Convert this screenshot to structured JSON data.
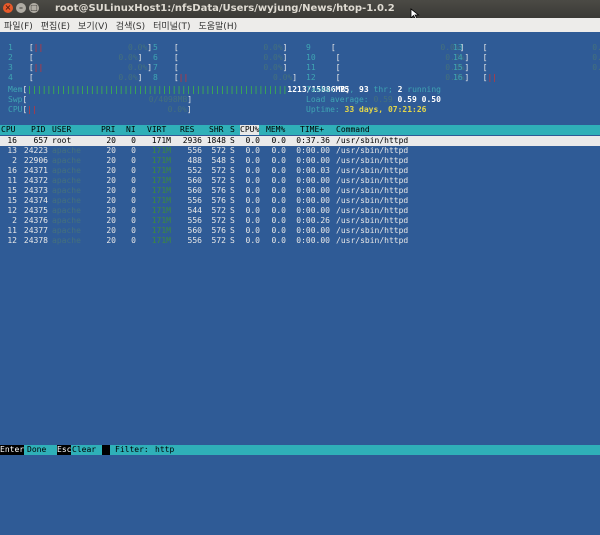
{
  "window": {
    "title": "root@SULinuxHost1:/nfsData/Users/wyjung/News/htop-1.0.2",
    "buttons": [
      "×",
      "–",
      "□"
    ]
  },
  "menu": [
    "파일(F)",
    "편집(E)",
    "보기(V)",
    "검색(S)",
    "터미널(T)",
    "도움말(H)"
  ],
  "meters": {
    "cpu_rows": [
      [
        {
          "n": "1",
          "bar": "||",
          "pct": "0.0%"
        },
        {
          "n": "5",
          "bar": "",
          "pct": "0.0%"
        },
        {
          "n": "9",
          "bar": "",
          "pct": "0.0%"
        },
        {
          "n": "13",
          "bar": "",
          "pct": "0.0%"
        }
      ],
      [
        {
          "n": "2",
          "bar": "",
          "pct": "0.0%"
        },
        {
          "n": "6",
          "bar": "",
          "pct": "0.0%"
        },
        {
          "n": "10",
          "bar": "",
          "pct": "0.0%"
        },
        {
          "n": "14",
          "bar": "",
          "pct": "0.0%"
        }
      ],
      [
        {
          "n": "3",
          "bar": "||",
          "pct": "0.0%"
        },
        {
          "n": "7",
          "bar": "",
          "pct": "0.0%"
        },
        {
          "n": "11",
          "bar": "",
          "pct": "0.0%"
        },
        {
          "n": "15",
          "bar": "",
          "pct": "0.0%"
        }
      ],
      [
        {
          "n": "4",
          "bar": "",
          "pct": "0.0%"
        },
        {
          "n": "8",
          "bar": "||",
          "pct": "0.0%"
        },
        {
          "n": "12",
          "bar": "",
          "pct": "0.0%"
        },
        {
          "n": "16",
          "bar": "||",
          "pct": "0.0%"
        }
      ]
    ],
    "mem_label": "Mem",
    "mem_bar": "||||||||||||||||||||||||||||||||||||||||||||||||||||||",
    "mem_value": "1213/15886MB",
    "swp_label": "Swp",
    "swp_value": "0/4098MB",
    "cpu_label": "CPU",
    "cpu_bar": "||",
    "cpu_pct": "0.0%",
    "tasks_label": "Tasks:",
    "tasks_value": "75",
    "thr_sep": ",",
    "thr_value": "93",
    "thr_label": "thr;",
    "running_value": "2",
    "running_label": "running",
    "load_label": "Load average:",
    "load_1": "0.59",
    "load_5": "0.59",
    "load_15": "0.50",
    "uptime_label": "Uptime:",
    "uptime_days": "33",
    "uptime_days_label": "days,",
    "uptime_time": "07:21:26"
  },
  "columns": [
    "CPU",
    "PID",
    "USER",
    "PRI",
    "NI",
    "VIRT",
    "RES",
    "SHR",
    "S",
    "CPU%",
    "MEM%",
    "TIME+",
    "Command"
  ],
  "processes": [
    {
      "cpu": "16",
      "pid": "657",
      "user": "root",
      "pri": "20",
      "ni": "0",
      "virt": "171M",
      "res": "2936",
      "shr": "1848",
      "s": "S",
      "cpup": "0.0",
      "memp": "0.0",
      "time": "0:37.36",
      "cmd": "/usr/sbin/httpd",
      "selected": true
    },
    {
      "cpu": "13",
      "pid": "24223",
      "user": "apache",
      "pri": "20",
      "ni": "0",
      "virt": "171M",
      "res": "556",
      "shr": "572",
      "s": "S",
      "cpup": "0.0",
      "memp": "0.0",
      "time": "0:00.00",
      "cmd": "/usr/sbin/httpd"
    },
    {
      "cpu": "2",
      "pid": "22906",
      "user": "apache",
      "pri": "20",
      "ni": "0",
      "virt": "171M",
      "res": "488",
      "shr": "548",
      "s": "S",
      "cpup": "0.0",
      "memp": "0.0",
      "time": "0:00.00",
      "cmd": "/usr/sbin/httpd"
    },
    {
      "cpu": "16",
      "pid": "24371",
      "user": "apache",
      "pri": "20",
      "ni": "0",
      "virt": "171M",
      "res": "552",
      "shr": "572",
      "s": "S",
      "cpup": "0.0",
      "memp": "0.0",
      "time": "0:00.03",
      "cmd": "/usr/sbin/httpd"
    },
    {
      "cpu": "11",
      "pid": "24372",
      "user": "apache",
      "pri": "20",
      "ni": "0",
      "virt": "171M",
      "res": "560",
      "shr": "572",
      "s": "S",
      "cpup": "0.0",
      "memp": "0.0",
      "time": "0:00.00",
      "cmd": "/usr/sbin/httpd"
    },
    {
      "cpu": "15",
      "pid": "24373",
      "user": "apache",
      "pri": "20",
      "ni": "0",
      "virt": "171M",
      "res": "560",
      "shr": "576",
      "s": "S",
      "cpup": "0.0",
      "memp": "0.0",
      "time": "0:00.00",
      "cmd": "/usr/sbin/httpd"
    },
    {
      "cpu": "15",
      "pid": "24374",
      "user": "apache",
      "pri": "20",
      "ni": "0",
      "virt": "171M",
      "res": "556",
      "shr": "576",
      "s": "S",
      "cpup": "0.0",
      "memp": "0.0",
      "time": "0:00.00",
      "cmd": "/usr/sbin/httpd"
    },
    {
      "cpu": "12",
      "pid": "24375",
      "user": "apache",
      "pri": "20",
      "ni": "0",
      "virt": "171M",
      "res": "544",
      "shr": "572",
      "s": "S",
      "cpup": "0.0",
      "memp": "0.0",
      "time": "0:00.00",
      "cmd": "/usr/sbin/httpd"
    },
    {
      "cpu": "2",
      "pid": "24376",
      "user": "apache",
      "pri": "20",
      "ni": "0",
      "virt": "171M",
      "res": "556",
      "shr": "572",
      "s": "S",
      "cpup": "0.0",
      "memp": "0.0",
      "time": "0:00.26",
      "cmd": "/usr/sbin/httpd"
    },
    {
      "cpu": "11",
      "pid": "24377",
      "user": "apache",
      "pri": "20",
      "ni": "0",
      "virt": "171M",
      "res": "560",
      "shr": "576",
      "s": "S",
      "cpup": "0.0",
      "memp": "0.0",
      "time": "0:00.00",
      "cmd": "/usr/sbin/httpd"
    },
    {
      "cpu": "12",
      "pid": "24378",
      "user": "apache",
      "pri": "20",
      "ni": "0",
      "virt": "171M",
      "res": "556",
      "shr": "572",
      "s": "S",
      "cpup": "0.0",
      "memp": "0.0",
      "time": "0:00.00",
      "cmd": "/usr/sbin/httpd"
    }
  ],
  "footer": {
    "key1": "Enter",
    "action1": "Done",
    "key2": "Esc",
    "action2": "Clear",
    "filter_label": "Filter:",
    "filter_value": "http"
  },
  "colors": {
    "background": "#2f5b96",
    "header_bar": "#2fb0b8",
    "selection": "#eaeaea"
  }
}
